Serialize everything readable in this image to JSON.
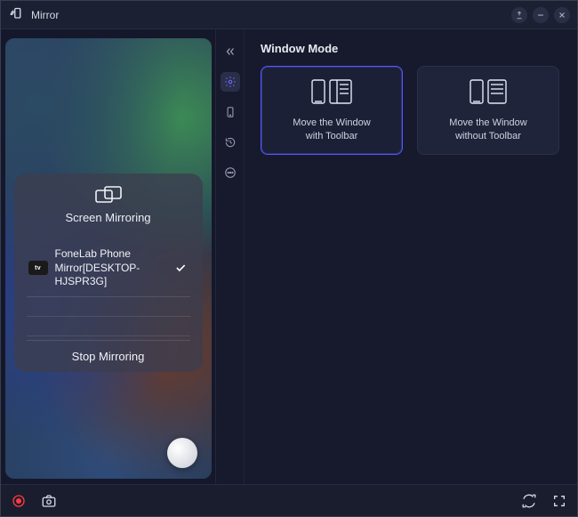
{
  "app": {
    "title": "Mirror"
  },
  "mirror_panel": {
    "title": "Screen Mirroring",
    "device_badge": "tv",
    "device_name": "FoneLab Phone Mirror[DESKTOP-HJSPR3G]",
    "stop_label": "Stop Mirroring"
  },
  "section": {
    "title": "Window Mode",
    "cards": [
      {
        "label": "Move the Window\nwith Toolbar"
      },
      {
        "label": "Move the Window\nwithout Toolbar"
      }
    ]
  },
  "toolbar": {
    "collapse": "«",
    "items": [
      "settings",
      "phone",
      "history",
      "more"
    ]
  }
}
